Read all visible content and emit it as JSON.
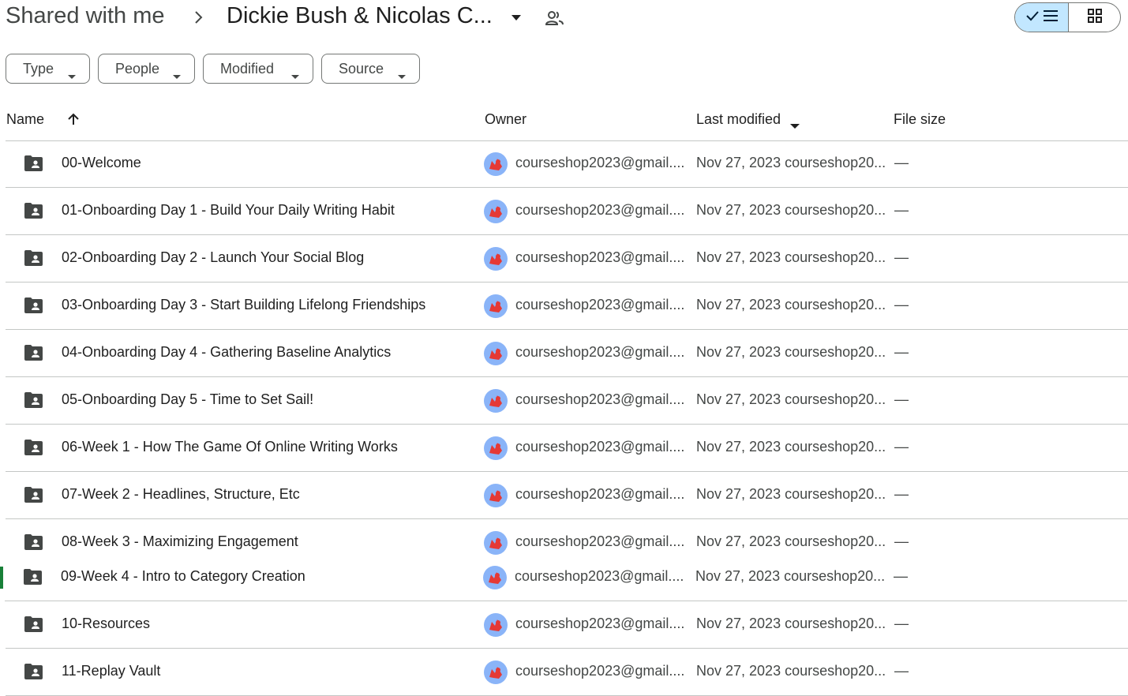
{
  "breadcrumb": {
    "root": "Shared with me",
    "current": "Dickie Bush & Nicolas C..."
  },
  "icons": {
    "separator": "chevron-right-icon",
    "folder_menu": "caret-down-icon",
    "shared": "people-icon",
    "list_view": "list-view-icon",
    "grid_view": "grid-view-icon",
    "row": "shared-folder-icon"
  },
  "view_toggle": {
    "selected": "list"
  },
  "filters": [
    {
      "label": "Type"
    },
    {
      "label": "People"
    },
    {
      "label": "Modified"
    },
    {
      "label": "Source"
    }
  ],
  "table": {
    "columns": {
      "name": "Name",
      "owner": "Owner",
      "last_modified": "Last modified",
      "file_size": "File size"
    },
    "sort": {
      "column": "Name",
      "direction": "ascending"
    },
    "rows": [
      {
        "name": "00-Welcome",
        "owner": "courseshop2023@gmail....",
        "modified": "Nov 27, 2023 courseshop20...",
        "size": "—"
      },
      {
        "name": "01-Onboarding Day 1 - Build Your Daily Writing Habit",
        "owner": "courseshop2023@gmail....",
        "modified": "Nov 27, 2023 courseshop20...",
        "size": "—"
      },
      {
        "name": "02-Onboarding Day 2 - Launch Your Social Blog",
        "owner": "courseshop2023@gmail....",
        "modified": "Nov 27, 2023 courseshop20...",
        "size": "—"
      },
      {
        "name": "03-Onboarding Day 3 - Start Building Lifelong Friendships",
        "owner": "courseshop2023@gmail....",
        "modified": "Nov 27, 2023 courseshop20...",
        "size": "—"
      },
      {
        "name": "04-Onboarding Day 4 - Gathering Baseline Analytics",
        "owner": "courseshop2023@gmail....",
        "modified": "Nov 27, 2023 courseshop20...",
        "size": "—"
      },
      {
        "name": "05-Onboarding Day 5 - Time to Set Sail!",
        "owner": "courseshop2023@gmail....",
        "modified": "Nov 27, 2023 courseshop20...",
        "size": "—"
      },
      {
        "name": "06-Week 1 - How The Game Of Online Writing Works",
        "owner": "courseshop2023@gmail....",
        "modified": "Nov 27, 2023 courseshop20...",
        "size": "—"
      },
      {
        "name": "07-Week 2 - Headlines, Structure, Etc",
        "owner": "courseshop2023@gmail....",
        "modified": "Nov 27, 2023 courseshop20...",
        "size": "—"
      },
      {
        "name": "08-Week 3 - Maximizing Engagement",
        "owner": "courseshop2023@gmail....",
        "modified": "Nov 27, 2023 courseshop20...",
        "size": "—"
      },
      {
        "name": "09-Week 4 - Intro to Category Creation",
        "owner": "courseshop2023@gmail....",
        "modified": "Nov 27, 2023 courseshop20...",
        "size": "—"
      },
      {
        "name": "10-Resources",
        "owner": "courseshop2023@gmail....",
        "modified": "Nov 27, 2023 courseshop20...",
        "size": "—"
      },
      {
        "name": "11-Replay Vault",
        "owner": "courseshop2023@gmail....",
        "modified": "Nov 27, 2023 courseshop20...",
        "size": "—"
      }
    ]
  },
  "colors": {
    "accent_selected": "#c2e7ff",
    "text_primary": "#1f1f1f",
    "text_secondary": "#444746",
    "divider": "#c4c7c5",
    "outline": "#747775",
    "avatar_bg": "#8ab4f8",
    "avatar_fg": "#e53935",
    "marker": "#188038"
  }
}
